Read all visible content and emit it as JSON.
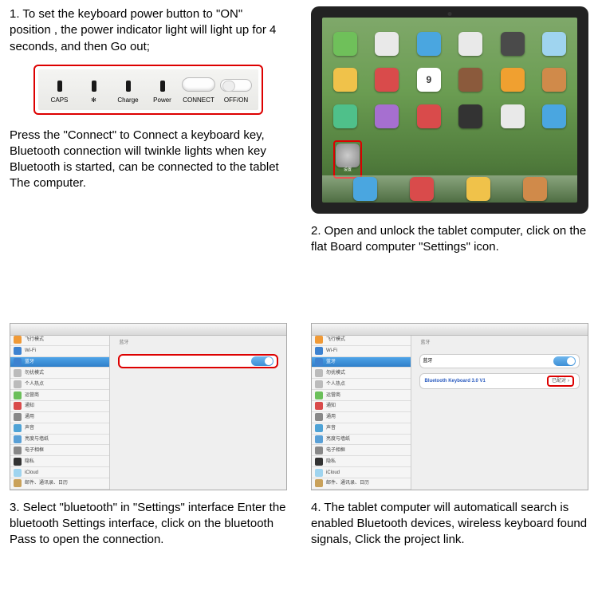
{
  "step1": {
    "intro": "1. To set the keyboard power button to \"ON\" position , the power indicator light will light up for 4 seconds, and then Go out;",
    "outro": "Press the \"Connect\" to Connect a keyboard key, Bluetooth connection will twinkle lights when key Bluetooth is started, can be connected to the tablet The computer.",
    "labels": {
      "caps": "CAPS",
      "bt": "✻",
      "charge": "Charge",
      "power": "Power",
      "connect": "CONNECT",
      "offon": "OFF/ON"
    }
  },
  "step2": {
    "caption": "2. Open and unlock the tablet computer, click on the flat Board computer \"Settings\" icon.",
    "highlight_label": "设置",
    "calendar_day": "9"
  },
  "step3": {
    "caption": "3. Select \"bluetooth\" in \"Settings\" interface Enter the bluetooth Settings interface, click on the bluetooth Pass to open the connection.",
    "section": "蓝牙"
  },
  "step4": {
    "caption": "4. The tablet computer will automaticall search is enabled Bluetooth devices, wireless keyboard found signals, Click the project link.",
    "section": "蓝牙",
    "device_name": "Bluetooth Keyboard 3.0 V1",
    "pair_status": "已配对"
  },
  "sidebar_items": [
    {
      "label": "飞行模式",
      "color": "#f09a37"
    },
    {
      "label": "Wi-Fi",
      "color": "#3d82d0"
    },
    {
      "label": "蓝牙",
      "color": "#3d82d0",
      "selected": true
    },
    {
      "label": "勿扰模式",
      "color": "#bbb"
    },
    {
      "label": "个人热点",
      "color": "#bbb"
    },
    {
      "label": "运营商",
      "color": "#6bbf5a"
    },
    {
      "label": "通知",
      "color": "#d94b4b"
    },
    {
      "label": "通用",
      "color": "#888"
    },
    {
      "label": "声音",
      "color": "#4fa3d6"
    },
    {
      "label": "亮度与墙纸",
      "color": "#5aa0d6"
    },
    {
      "label": "电子相框",
      "color": "#888"
    },
    {
      "label": "隐私",
      "color": "#333"
    },
    {
      "label": "iCloud",
      "color": "#9fd4ef"
    },
    {
      "label": "邮件、通讯录、日历",
      "color": "#c9a15a"
    }
  ],
  "home_apps": {
    "row1": [
      "#6fc05a",
      "#e9e9e9",
      "#4aa6e0",
      "#e9e9e9",
      "#4a4a4a",
      "#9fd4ef"
    ],
    "row2": [
      "#f0c24a",
      "#d94b4b",
      "#ffffff",
      "#8b5a3c",
      "#f0a030",
      "#d08a4a"
    ],
    "row3": [
      "#4fc08a",
      "#a66fd0",
      "#d94b4b",
      "#333333",
      "#e9e9e9",
      "#4aa6e0"
    ],
    "dock": [
      "#4aa6e0",
      "#d94b4b",
      "#f0c24a",
      "#d08a4a"
    ]
  }
}
